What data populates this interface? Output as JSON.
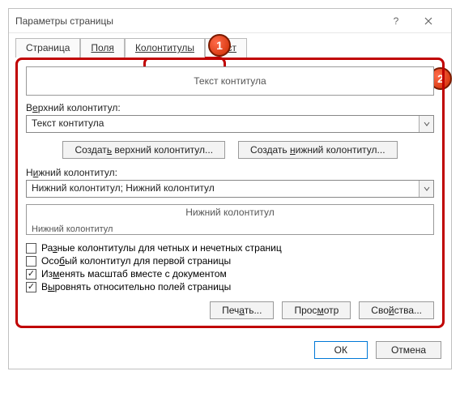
{
  "titlebar": {
    "title": "Параметры страницы"
  },
  "tabs": {
    "page": "Страница",
    "fields": "Поля",
    "headers": "Колонтитулы",
    "sheet": "Лист"
  },
  "annotations": {
    "badge1": "1",
    "badge2": "2"
  },
  "header_preview": "Текст контитула",
  "top_header": {
    "label_pre": "В",
    "label_u": "е",
    "label_post": "рхний колонтитул:",
    "value": "Текст контитула"
  },
  "create_top": {
    "pre": "Создат",
    "u": "ь",
    "post": " верхний колонтитул..."
  },
  "create_bottom": {
    "pre": "Создать ",
    "u": "н",
    "post": "ижний колонтитул..."
  },
  "bottom_header": {
    "label_pre": "Н",
    "label_u": "и",
    "label_post": "жний колонтитул:",
    "value": "Нижний колонтитул; Нижний колонтитул"
  },
  "footer_preview": {
    "center": "Нижний колонтитул",
    "left": "Нижний колонтитул"
  },
  "checkboxes": {
    "diff_odd_even": {
      "pre": "Ра",
      "u": "з",
      "post": "ные колонтитулы для четных и нечетных страниц"
    },
    "diff_first": {
      "pre": "Осо",
      "u": "б",
      "post": "ый колонтитул для первой страницы"
    },
    "scale": {
      "pre": "Из",
      "u": "м",
      "post": "енять масштаб вместе с документом"
    },
    "align": {
      "pre": "В",
      "u": "ы",
      "post": "ровнять относительно полей страницы"
    }
  },
  "buttons": {
    "print": {
      "pre": "Печ",
      "u": "а",
      "post": "ть..."
    },
    "preview": {
      "pre": "Прос",
      "u": "м",
      "post": "отр"
    },
    "props": {
      "pre": "Сво",
      "u": "й",
      "post": "ства..."
    },
    "ok": "ОК",
    "cancel": "Отмена"
  }
}
